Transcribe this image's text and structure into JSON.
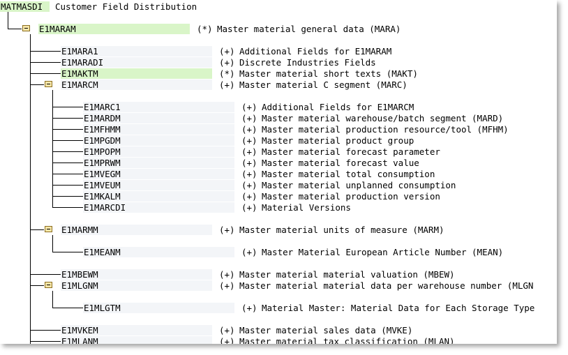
{
  "root": {
    "name": "MATMASDI",
    "desc": "Customer Field Distribution"
  },
  "level1": {
    "name": "E1MARAM",
    "status": "(*)",
    "desc": "Master material general data (MARA)",
    "expanded": true
  },
  "level2": [
    {
      "name": "E1MARA1",
      "status": "(+)",
      "desc": "Additional Fields for E1MARAM"
    },
    {
      "name": "E1MARADI",
      "status": "(+)",
      "desc": "Discrete Industries Fields"
    },
    {
      "name": "E1MAKTM",
      "status": "(*)",
      "desc": "Master material short texts (MAKT)"
    },
    {
      "name": "E1MARCM",
      "status": "(+)",
      "desc": "Master material C segment (MARC)"
    },
    {
      "name": "E1MARMM",
      "status": "(+)",
      "desc": "Master material units of measure (MARM)"
    },
    {
      "name": "E1MBEWM",
      "status": "(+)",
      "desc": "Master material material valuation (MBEW)"
    },
    {
      "name": "E1MLGNM",
      "status": "(+)",
      "desc": "Master material material data per warehouse number (MLGN"
    },
    {
      "name": "E1MVKEM",
      "status": "(+)",
      "desc": "Master material sales data (MVKE)"
    },
    {
      "name": "E1MLANM",
      "status": "(+)",
      "desc": "Master material tax classification (MLAN)"
    }
  ],
  "marc_children": [
    {
      "name": "E1MARC1",
      "status": "(+)",
      "desc": "Additional Fields for E1MARCM"
    },
    {
      "name": "E1MARDM",
      "status": "(+)",
      "desc": "Master material warehouse/batch segment (MARD)"
    },
    {
      "name": "E1MFHMM",
      "status": "(+)",
      "desc": "Master material production resource/tool (MFHM)"
    },
    {
      "name": "E1MPGDM",
      "status": "(+)",
      "desc": "Master material product group"
    },
    {
      "name": "E1MPOPM",
      "status": "(+)",
      "desc": "Master material forecast parameter"
    },
    {
      "name": "E1MPRWM",
      "status": "(+)",
      "desc": "Master material forecast value"
    },
    {
      "name": "E1MVEGM",
      "status": "(+)",
      "desc": "Master material total consumption"
    },
    {
      "name": "E1MVEUM",
      "status": "(+)",
      "desc": "Master material unplanned consumption"
    },
    {
      "name": "E1MKALM",
      "status": "(+)",
      "desc": "Master material production version"
    },
    {
      "name": "E1MARCDI",
      "status": "(+)",
      "desc": "Material Versions"
    }
  ],
  "marm_children": [
    {
      "name": "E1MEANM",
      "status": "(+)",
      "desc": "Master Material European Article Number (MEAN)"
    }
  ],
  "mlgn_children": [
    {
      "name": "E1MLGTM",
      "status": "(+)",
      "desc": "Material Master: Material Data for Each Storage Type"
    }
  ],
  "colors": {
    "highlight": "#d9f5c8",
    "field": "#f3f5f8",
    "folder": "#c8a24a"
  }
}
